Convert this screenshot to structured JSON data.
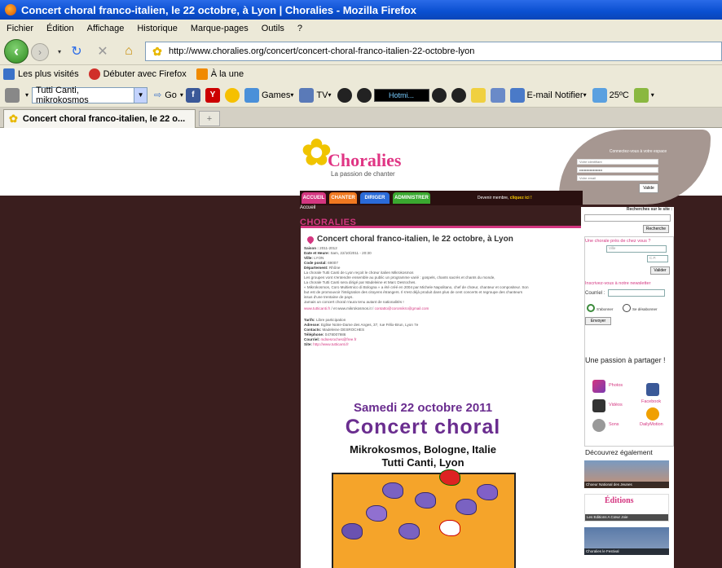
{
  "window": {
    "title": "Concert choral franco-italien, le 22 octobre, à Lyon | Choralies - Mozilla Firefox"
  },
  "menu": [
    "Fichier",
    "Édition",
    "Affichage",
    "Historique",
    "Marque-pages",
    "Outils",
    "?"
  ],
  "nav": {
    "url": "http://www.choralies.org/concert/concert-choral-franco-italien-22-octobre-lyon"
  },
  "bookmarks": [
    "Les plus visités",
    "Débuter avec Firefox",
    "À la une"
  ],
  "toolbar": {
    "search_value": "Tutti Canti, mikrokosmos",
    "go_label": "Go",
    "games_label": "Games",
    "tv_label": "TV",
    "hotmail_label": "Hotmi...",
    "email_label": "E-mail Notifier",
    "weather": "25ºC"
  },
  "tab": {
    "label": "Concert choral franco-italien, le 22 o..."
  },
  "site": {
    "logo_name": "Choralies",
    "logo_tagline": "La passion de chanter",
    "login": {
      "title": "Connectez-vous à votre espace",
      "user_placeholder": "Votre identifiant",
      "pass_value": "••••••••••••••••••••",
      "email_placeholder": "Votre email",
      "ok": "Valide"
    },
    "nav_tabs": [
      "ACCUEIL",
      "CHANTER",
      "DIRIGER",
      "ADMINISTRER"
    ],
    "membre": "Devenir membre,",
    "membre_link": "cliquez ici !",
    "breadcrumb": "Accueil",
    "section_heading": "CHORALIES"
  },
  "article": {
    "title": "Concert choral franco-italien, le 22 octobre, à Lyon",
    "meta": [
      {
        "k": "Saison :",
        "v": "2011-2012"
      },
      {
        "k": "Date et Heure:",
        "v": "Sam, 22/10/2011 - 20:30"
      },
      {
        "k": "Ville:",
        "v": "LYON"
      },
      {
        "k": "Code postal:",
        "v": "69007"
      },
      {
        "k": "Département:",
        "v": "Rhône"
      }
    ],
    "body": [
      "La chorale Tutti Canti de Lyon reçoit le chœur italien Mikrokosmos",
      "Les groupes vont s'entendre ensemble au public un programme varié : gospels, chants sacrés et chants du monde,",
      "La chorale Tutti Canti sera dirigé par Madeleine et Marc Desroches.",
      "« Mikrokosmos, Coro Multietnico di Bologna » a été créé en 2004 par Michele Napolitano, chef de chœur, chanteur et compositeur. Son",
      "but est de promouvoir l'intégration des citoyens étrangers. Il s'est déjà produit dans plus de cent concerts et regroupe des chanteurs",
      "issus d'une trentaine de pays.",
      "Jamais un concert choral n'aura tenu autant de nationalités !"
    ],
    "links": [
      "www.tutticanti.fr",
      "et  www.mikrokosmos.it  /",
      "contatto@coromikro@gmail.com"
    ],
    "info": [
      {
        "k": "Tarifs:",
        "v": "Libre participation"
      },
      {
        "k": "Adresse:",
        "v": "Eglise Notre-Dame des Anges, 37, rue Félix-Brun, Lyon 7e"
      },
      {
        "k": "Contacts:",
        "v": "Madeleine DESROCHES"
      },
      {
        "k": "Téléphone:",
        "v": "0478007986"
      },
      {
        "k": "Courriel:",
        "v": "mdsesroches@free.fr"
      },
      {
        "k": "Site:",
        "v": "http://www.tutticanti.fr"
      }
    ],
    "poster": {
      "line1": "Samedi 22 octobre 2011",
      "line2": "Concert choral",
      "line3": "Mikrokosmos, Bologne, Italie",
      "line4": "Tutti Canti, Lyon"
    }
  },
  "sidebar": {
    "search_label": "Recherches sur le site :",
    "search_btn": "Recherche",
    "chorale_label": "Une chorale près de chez vous ?",
    "ville_placeholder": "Ville",
    "cp_placeholder": "C.P.",
    "valider": "Valider",
    "newsletter": "Inscrivez-vous à notre newsletter",
    "courriel_label": "Courriel :",
    "sabonner": "S'abonner",
    "desabonner": "Se désabonner",
    "envoyer": "Envoyer",
    "passion": "Une passion à partager !",
    "media": [
      "Photos",
      "Vidéos",
      "Sons",
      "Facebook",
      "DailyMotion"
    ],
    "decouvrez": "Découvrez également",
    "thumbs": [
      "Choeur National des Jeunes",
      "Les Editions A Cœur Joie",
      "Choralies le Festival"
    ]
  }
}
